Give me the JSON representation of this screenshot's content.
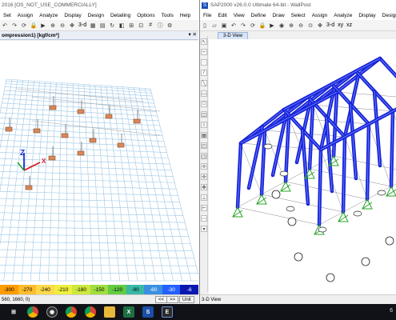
{
  "left_window": {
    "title": "2016  [OS_NOT_USE_COMMERCIALLY]",
    "menu": [
      "Set",
      "Assign",
      "Analyze",
      "Display",
      "Design",
      "Detailing",
      "Options",
      "Tools",
      "Help"
    ],
    "toolbar_text": "3-d",
    "panel_title": "ompression1) [kgf/cm²]",
    "legend_values": [
      "-300",
      "-270",
      "-240",
      "-210",
      "-180",
      "-150",
      "-120",
      "-90",
      "-60",
      "-30",
      "-6"
    ],
    "legend_colors": [
      "#ff9d00",
      "#ffbd2e",
      "#ffd94a",
      "#f0ef3f",
      "#cde83c",
      "#9fde3e",
      "#63cc43",
      "#39b8a6",
      "#3b8fe0",
      "#2460ff",
      "#0a18b0"
    ],
    "status_text": "560, 1660, 0)",
    "nav_buttons": [
      "<<",
      ">>"
    ],
    "units_button": "Unit"
  },
  "right_window": {
    "title": "SAP2000 v26.0.0 Ultimate 64-bit - WallPost",
    "menu": [
      "File",
      "Edit",
      "View",
      "Define",
      "Draw",
      "Select",
      "Assign",
      "Analyze",
      "Display",
      "Design",
      "Opt"
    ],
    "toolbar_text_a": "3-d",
    "toolbar_text_b": "xy",
    "toolbar_text_c": "xz",
    "tab_label": "3-D View",
    "status_label": "3-D View"
  },
  "taskbar": {
    "items": [
      "windows-start",
      "chrome",
      "obs",
      "chrome",
      "chrome",
      "files",
      "excel",
      "sap2000",
      "etabs"
    ],
    "tray_text": "6"
  }
}
